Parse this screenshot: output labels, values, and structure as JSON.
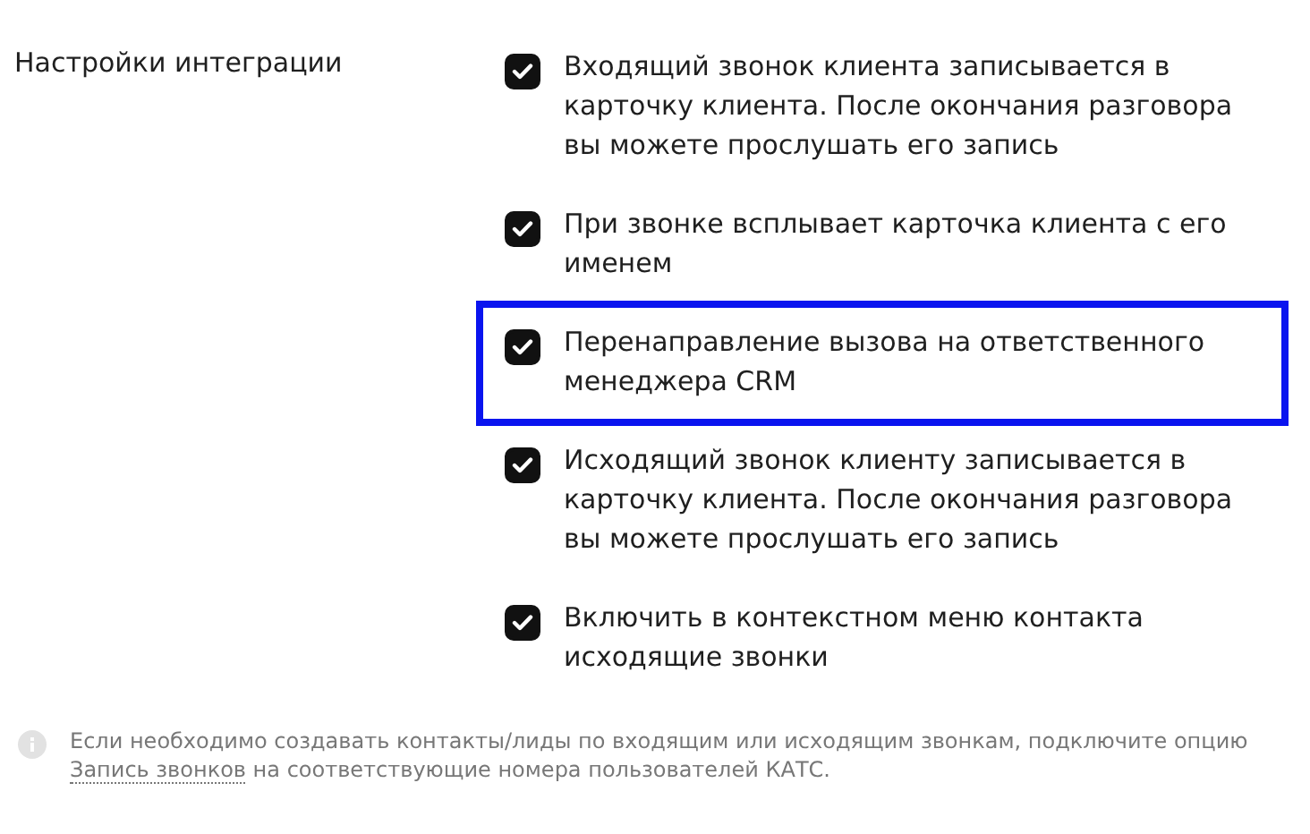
{
  "section_label": "Настройки интеграции",
  "options": [
    {
      "text": "Входящий звонок клиента записывается в карточку клиента. После окончания разговора вы можете прослушать его запись",
      "checked": true,
      "highlighted": false
    },
    {
      "text": "При звонке всплывает карточка клиента с его именем",
      "checked": true,
      "highlighted": false
    },
    {
      "text": "Перенаправление вызова на ответственного менеджера CRM",
      "checked": true,
      "highlighted": true
    },
    {
      "text": "Исходящий звонок клиенту записывается в карточку клиента. После окончания разговора вы можете прослушать его запись",
      "checked": true,
      "highlighted": false
    },
    {
      "text": "Включить в контекстном меню контакта исходящие звонки",
      "checked": true,
      "highlighted": false
    }
  ],
  "note": {
    "text_before": "Если необходимо создавать контакты/лиды по входящим или исходящим звонкам, подключите опцию",
    "link": "Запись звонков",
    "text_after": "на соответствующие номера пользователей КАТС."
  }
}
